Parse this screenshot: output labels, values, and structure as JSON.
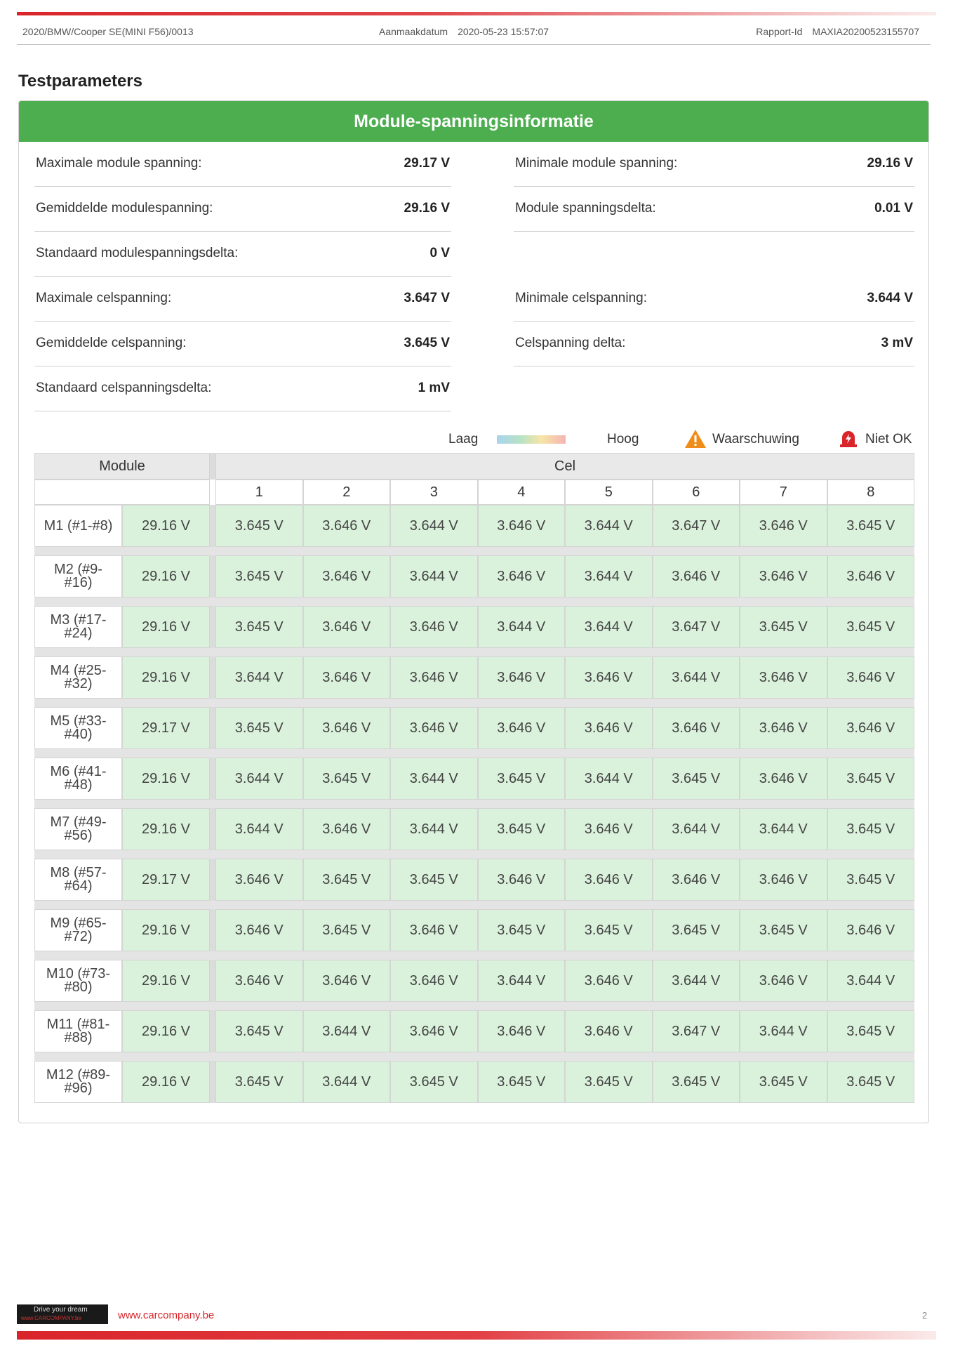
{
  "header": {
    "vehicle": "2020/BMW/Cooper SE(MINI F56)/0013",
    "date_label": "Aanmaakdatum",
    "date_value": "2020-05-23 15:57:07",
    "report_label": "Rapport-Id",
    "report_value": "MAXIA20200523155707"
  },
  "section_title": "Testparameters",
  "card_title": "Module-spanningsinformatie",
  "params": {
    "max_module_label": "Maximale module spanning:",
    "max_module_value": "29.17 V",
    "min_module_label": "Minimale module spanning:",
    "min_module_value": "29.16 V",
    "avg_module_label": "Gemiddelde modulespanning:",
    "avg_module_value": "29.16 V",
    "delta_module_label": "Module spanningsdelta:",
    "delta_module_value": "0.01 V",
    "std_module_label": "Standaard modulespanningsdelta:",
    "std_module_value": "0 V",
    "max_cell_label": "Maximale celspanning:",
    "max_cell_value": "3.647 V",
    "min_cell_label": "Minimale celspanning:",
    "min_cell_value": "3.644 V",
    "avg_cell_label": "Gemiddelde celspanning:",
    "avg_cell_value": "3.645 V",
    "delta_cell_label": "Celspanning delta:",
    "delta_cell_value": "3 mV",
    "std_cell_label": "Standaard celspanningsdelta:",
    "std_cell_value": "1 mV"
  },
  "legend": {
    "low": "Laag",
    "high": "Hoog",
    "warning": "Waarschuwing",
    "not_ok": "Niet OK",
    "warning_icon": "warning-triangle-icon",
    "not_ok_icon": "error-alarm-icon",
    "colors": {
      "good": "#daf2dc",
      "header": "#4cae4f",
      "accent": "#d9252a"
    }
  },
  "table": {
    "module_header": "Module",
    "cell_header": "Cel",
    "cell_numbers": [
      "1",
      "2",
      "3",
      "4",
      "5",
      "6",
      "7",
      "8"
    ],
    "rows": [
      {
        "name": "M1 (#1-#8)",
        "module": "29.16 V",
        "cells": [
          "3.645 V",
          "3.646 V",
          "3.644 V",
          "3.646 V",
          "3.644 V",
          "3.647 V",
          "3.646 V",
          "3.645 V"
        ]
      },
      {
        "name": "M2 (#9-#16)",
        "module": "29.16 V",
        "cells": [
          "3.645 V",
          "3.646 V",
          "3.644 V",
          "3.646 V",
          "3.644 V",
          "3.646 V",
          "3.646 V",
          "3.646 V"
        ]
      },
      {
        "name": "M3 (#17-#24)",
        "module": "29.16 V",
        "cells": [
          "3.645 V",
          "3.646 V",
          "3.646 V",
          "3.644 V",
          "3.644 V",
          "3.647 V",
          "3.645 V",
          "3.645 V"
        ]
      },
      {
        "name": "M4 (#25-#32)",
        "module": "29.16 V",
        "cells": [
          "3.644 V",
          "3.646 V",
          "3.646 V",
          "3.646 V",
          "3.646 V",
          "3.644 V",
          "3.646 V",
          "3.646 V"
        ]
      },
      {
        "name": "M5 (#33-#40)",
        "module": "29.17 V",
        "cells": [
          "3.645 V",
          "3.646 V",
          "3.646 V",
          "3.646 V",
          "3.646 V",
          "3.646 V",
          "3.646 V",
          "3.646 V"
        ]
      },
      {
        "name": "M6 (#41-#48)",
        "module": "29.16 V",
        "cells": [
          "3.644 V",
          "3.645 V",
          "3.644 V",
          "3.645 V",
          "3.644 V",
          "3.645 V",
          "3.646 V",
          "3.645 V"
        ]
      },
      {
        "name": "M7 (#49-#56)",
        "module": "29.16 V",
        "cells": [
          "3.644 V",
          "3.646 V",
          "3.644 V",
          "3.645 V",
          "3.646 V",
          "3.644 V",
          "3.644 V",
          "3.645 V"
        ]
      },
      {
        "name": "M8 (#57-#64)",
        "module": "29.17 V",
        "cells": [
          "3.646 V",
          "3.645 V",
          "3.645 V",
          "3.646 V",
          "3.646 V",
          "3.646 V",
          "3.646 V",
          "3.645 V"
        ]
      },
      {
        "name": "M9 (#65-#72)",
        "module": "29.16 V",
        "cells": [
          "3.646 V",
          "3.645 V",
          "3.646 V",
          "3.645 V",
          "3.645 V",
          "3.645 V",
          "3.645 V",
          "3.646 V"
        ]
      },
      {
        "name": "M10 (#73-#80)",
        "module": "29.16 V",
        "cells": [
          "3.646 V",
          "3.646 V",
          "3.646 V",
          "3.644 V",
          "3.646 V",
          "3.644 V",
          "3.646 V",
          "3.644 V"
        ]
      },
      {
        "name": "M11 (#81-#88)",
        "module": "29.16 V",
        "cells": [
          "3.645 V",
          "3.644 V",
          "3.646 V",
          "3.646 V",
          "3.646 V",
          "3.647 V",
          "3.644 V",
          "3.645 V"
        ]
      },
      {
        "name": "M12 (#89-#96)",
        "module": "29.16 V",
        "cells": [
          "3.645 V",
          "3.644 V",
          "3.645 V",
          "3.645 V",
          "3.645 V",
          "3.645 V",
          "3.645 V",
          "3.645 V"
        ]
      }
    ]
  },
  "footer": {
    "logo_line1": "Drive your dream",
    "logo_line2": "www.CARCOMPANY.be",
    "url": "www.carcompany.be",
    "page": "2"
  }
}
